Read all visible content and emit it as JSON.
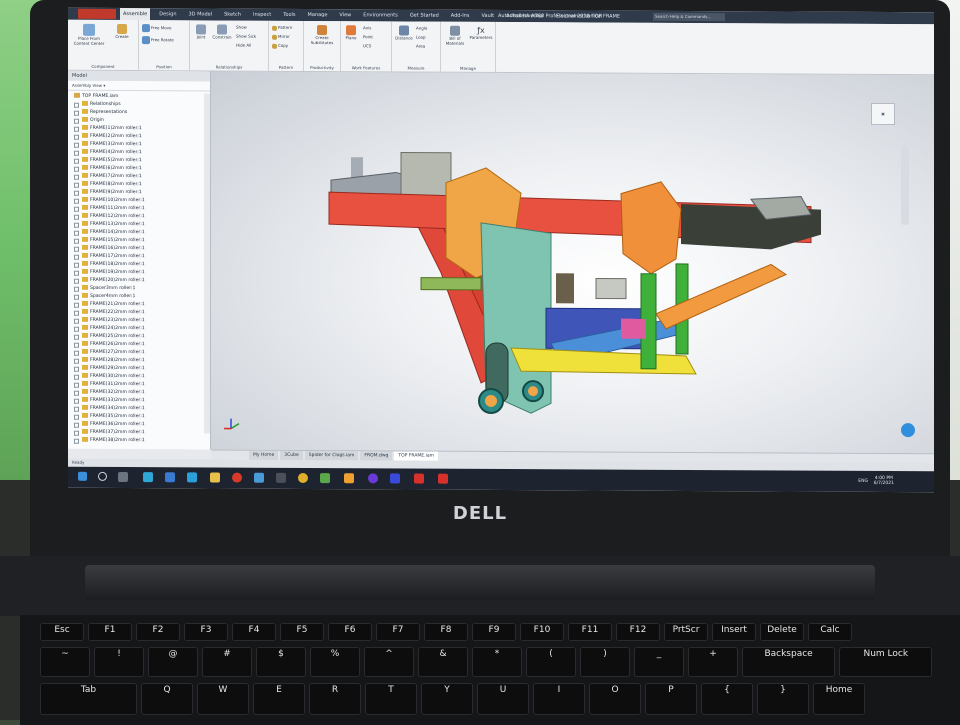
{
  "window": {
    "title": "Autodesk Inventor Professional 2018  TOP FRAME",
    "search_placeholder": "Search Help & Commands..."
  },
  "ribbon_tabs": [
    "Assemble",
    "Design",
    "3D Model",
    "Sketch",
    "Inspect",
    "Tools",
    "Manage",
    "View",
    "Environments",
    "Get Started",
    "Add-Ins",
    "Vault",
    "Autodesk A360",
    "Electromechanical"
  ],
  "ribbon_groups": [
    {
      "label": "Component",
      "buttons": [
        "Place From Content Center",
        "Create"
      ]
    },
    {
      "label": "Position",
      "buttons": [
        "Free Move",
        "Free Rotate"
      ]
    },
    {
      "label": "Relationships",
      "buttons": [
        "Joint",
        "Constrain",
        "Show",
        "Show Sick",
        "Hide All"
      ]
    },
    {
      "label": "Pattern",
      "buttons": [
        "Pattern",
        "Mirror",
        "Copy"
      ]
    },
    {
      "label": "Productivity",
      "buttons": [
        "Create Substitutes"
      ]
    },
    {
      "label": "Work Features",
      "buttons": [
        "Plane",
        "Axis",
        "Point",
        "UCS"
      ]
    },
    {
      "label": "Measure",
      "buttons": [
        "Distance",
        "Angle",
        "Loop",
        "Area"
      ]
    },
    {
      "label": "Manage",
      "buttons": [
        "Bill of Materials",
        "Parameters"
      ]
    }
  ],
  "browser": {
    "header": "Model",
    "view_selector": "Assembly View",
    "root": "TOP FRAME.iam",
    "items": [
      "Relationships",
      "Representations",
      "Origin",
      "FRAME(1)2mm roller:1",
      "FRAME(2)2mm roller:1",
      "FRAME(3)2mm roller:1",
      "FRAME(4)2mm roller:1",
      "FRAME(5)2mm roller:1",
      "FRAME(6)2mm roller:1",
      "FRAME(7)2mm roller:1",
      "FRAME(8)2mm roller:1",
      "FRAME(9)2mm roller:1",
      "FRAME(10)2mm roller:1",
      "FRAME(11)2mm roller:1",
      "FRAME(12)2mm roller:1",
      "FRAME(13)2mm roller:1",
      "FRAME(14)2mm roller:1",
      "FRAME(15)2mm roller:1",
      "FRAME(16)2mm roller:1",
      "FRAME(17)2mm roller:1",
      "FRAME(18)2mm roller:1",
      "FRAME(19)2mm roller:1",
      "FRAME(20)2mm roller:1",
      "Spacer3mm roller:1",
      "Spacer4mm roller:1",
      "FRAME(21)2mm roller:1",
      "FRAME(22)2mm roller:1",
      "FRAME(23)2mm roller:1",
      "FRAME(24)2mm roller:1",
      "FRAME(25)2mm roller:1",
      "FRAME(26)2mm roller:1",
      "FRAME(27)2mm roller:1",
      "FRAME(28)2mm roller:1",
      "FRAME(29)2mm roller:1",
      "FRAME(30)2mm roller:1",
      "FRAME(31)2mm roller:1",
      "FRAME(32)2mm roller:1",
      "FRAME(33)2mm roller:1",
      "FRAME(34)2mm roller:1",
      "FRAME(35)2mm roller:1",
      "FRAME(36)2mm roller:1",
      "FRAME(37)2mm roller:1",
      "FRAME(38)2mm roller:1"
    ]
  },
  "document_tabs": [
    "My Home",
    "3Cube",
    "Spider for Clogs.iam",
    "FROM.dwg",
    "TOP FRAME.iam"
  ],
  "active_document": "TOP FRAME.iam",
  "status_text": "Ready",
  "tray": {
    "time": "4:00 PM",
    "date": "6/7/2021",
    "lang": "ENG"
  },
  "laptop_logo": "DELL",
  "keyboard": {
    "row1": [
      "Esc",
      "F1",
      "F2",
      "F3",
      "F4",
      "F5",
      "F6",
      "F7",
      "F8",
      "F9",
      "F10",
      "F11",
      "F12",
      "PrtScr",
      "Insert",
      "Delete",
      "Calc"
    ],
    "row2": [
      "~",
      "!",
      "@",
      "#",
      "$",
      "%",
      "^",
      "&",
      "*",
      "(",
      ")",
      "_",
      "+",
      "Backspace",
      "Num Lock"
    ],
    "row3": [
      "Tab",
      "Q",
      "W",
      "E",
      "R",
      "T",
      "Y",
      "U",
      "I",
      "O",
      "P",
      "{",
      "}",
      "Home"
    ]
  }
}
